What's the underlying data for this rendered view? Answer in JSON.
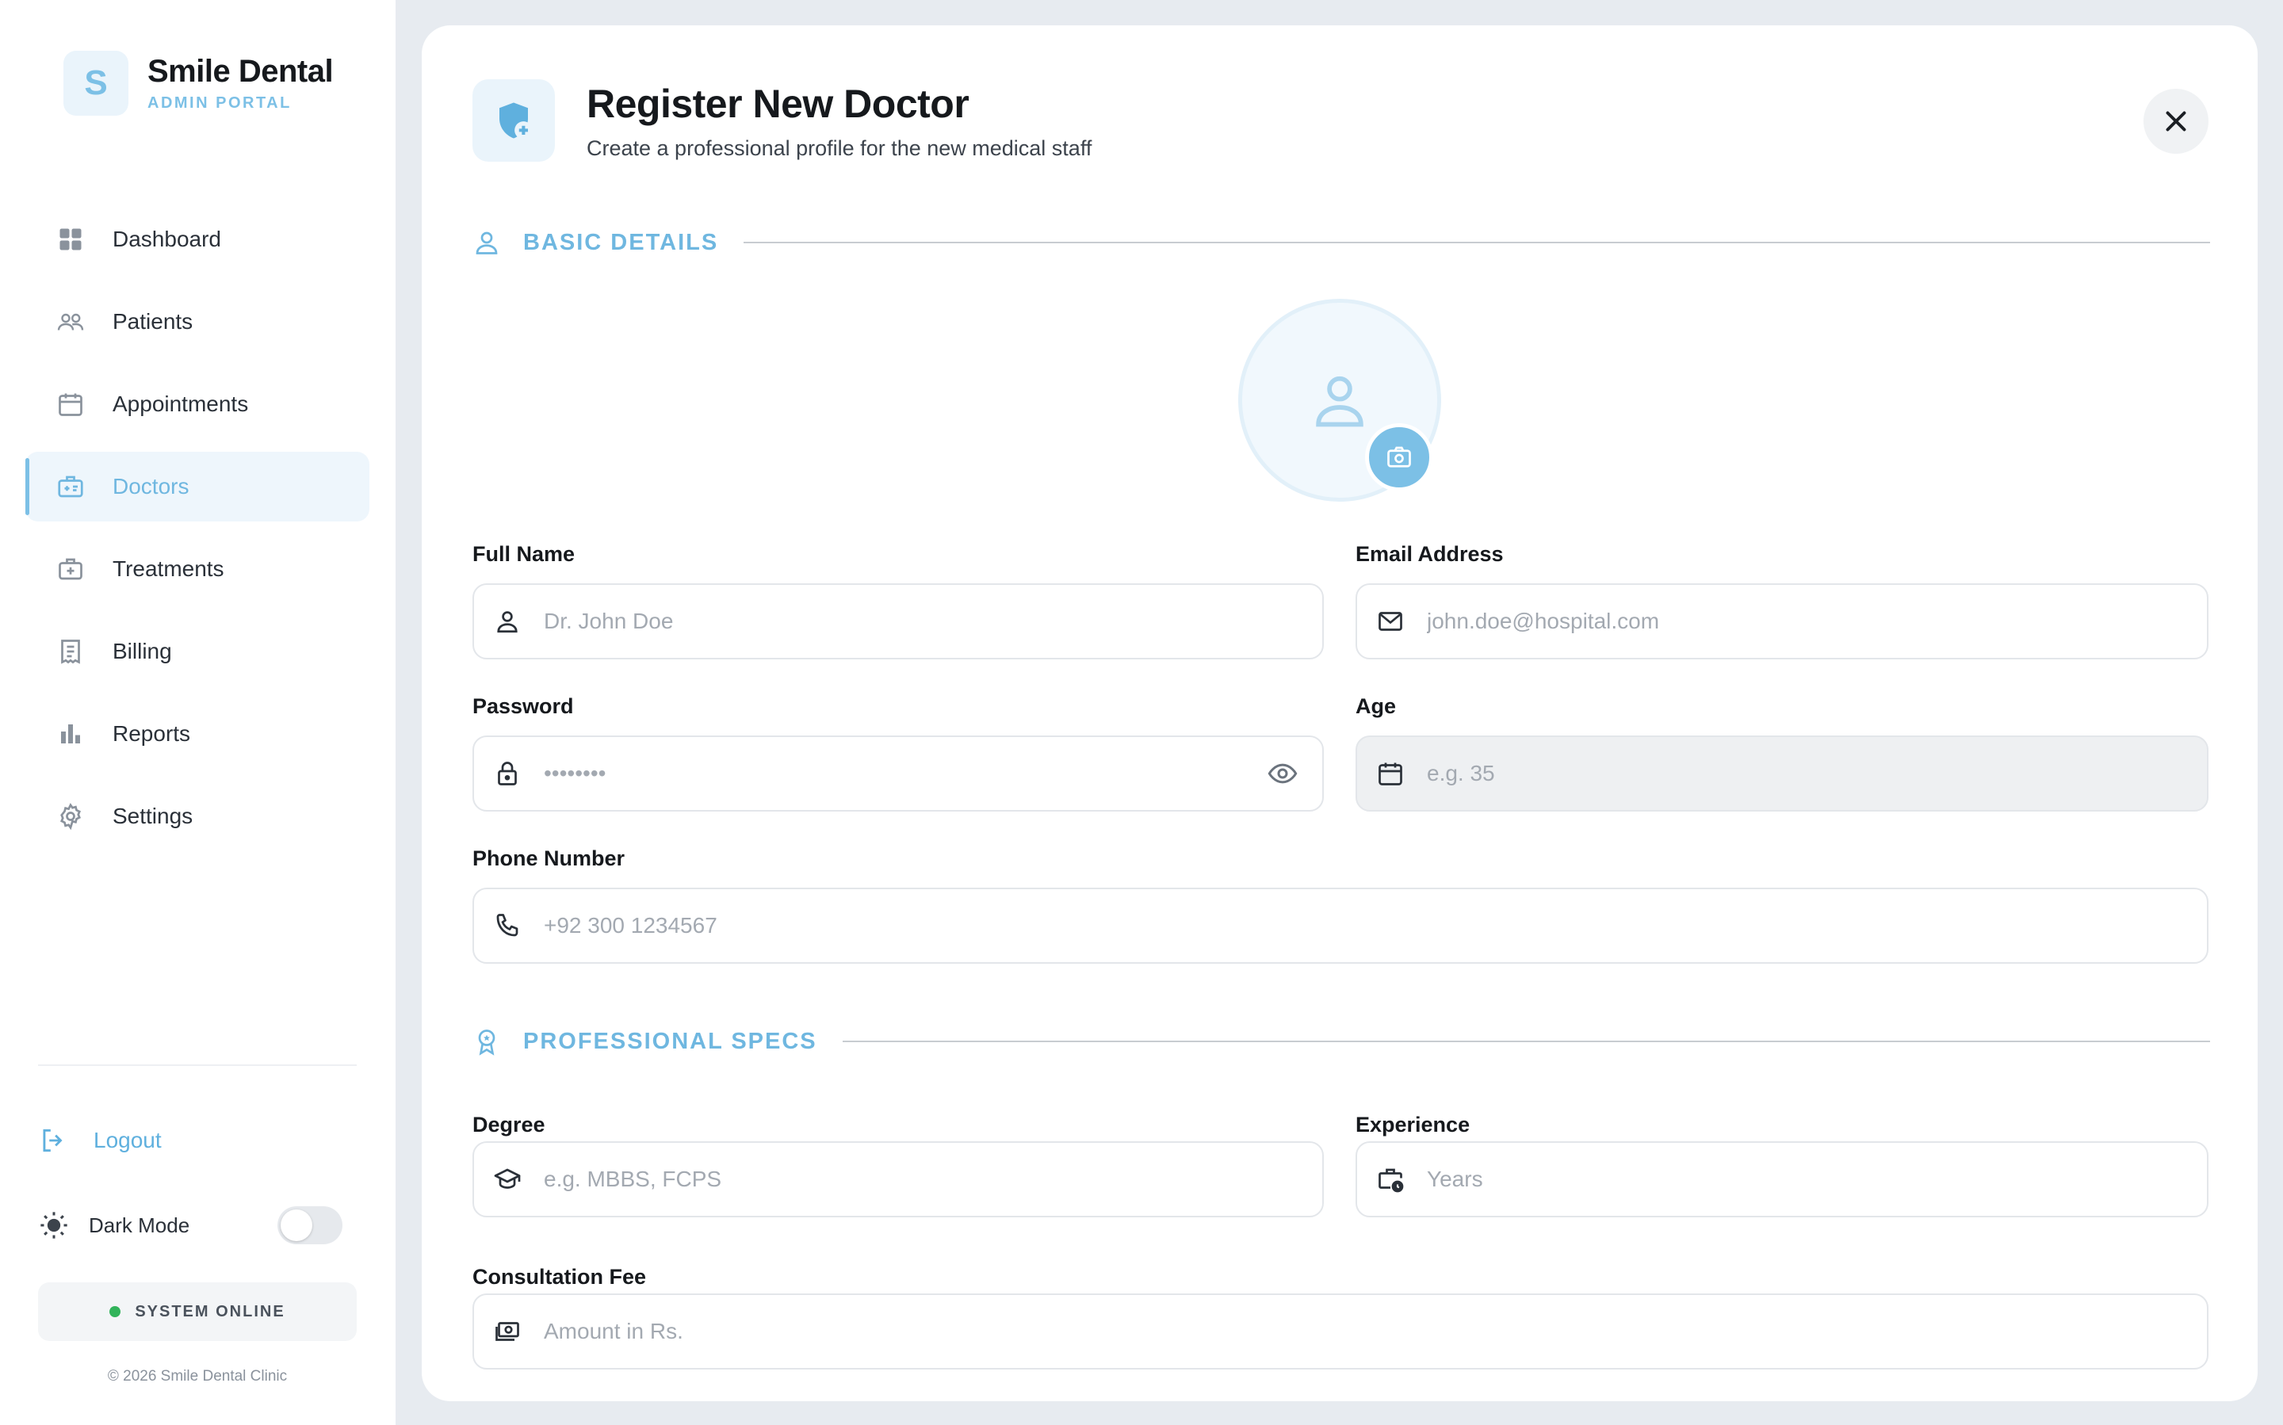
{
  "colors": {
    "accent": "#7cc0e6",
    "accent_text": "#6fb7e0",
    "status_online": "#31b35a",
    "background": "#e7ebf0"
  },
  "brand": {
    "logo_letter": "S",
    "name": "Smile Dental",
    "subtitle": "ADMIN PORTAL"
  },
  "sidebar": {
    "items": [
      {
        "label": "Dashboard",
        "icon": "grid-icon"
      },
      {
        "label": "Patients",
        "icon": "users-icon"
      },
      {
        "label": "Appointments",
        "icon": "calendar-icon"
      },
      {
        "label": "Doctors",
        "icon": "medical-id-icon",
        "active": true
      },
      {
        "label": "Treatments",
        "icon": "medical-case-icon"
      },
      {
        "label": "Billing",
        "icon": "receipt-icon"
      },
      {
        "label": "Reports",
        "icon": "bar-chart-icon"
      },
      {
        "label": "Settings",
        "icon": "gear-icon"
      }
    ],
    "logout_label": "Logout",
    "dark_mode_label": "Dark Mode",
    "dark_mode_on": false,
    "system_status": "SYSTEM ONLINE",
    "copyright": "© 2026 Smile Dental Clinic"
  },
  "modal": {
    "title": "Register New Doctor",
    "subtitle": "Create a professional profile for the new medical staff",
    "sections": {
      "basic": "BASIC DETAILS",
      "professional": "PROFESSIONAL SPECS"
    },
    "fields": {
      "full_name": {
        "label": "Full Name",
        "placeholder": "Dr. John Doe",
        "value": ""
      },
      "email": {
        "label": "Email Address",
        "placeholder": "john.doe@hospital.com",
        "value": ""
      },
      "password": {
        "label": "Password",
        "placeholder": "••••••••",
        "value": ""
      },
      "age": {
        "label": "Age",
        "placeholder": "e.g. 35",
        "value": "",
        "disabled": true
      },
      "phone": {
        "label": "Phone Number",
        "placeholder": "+92 300 1234567",
        "value": ""
      },
      "degree": {
        "label": "Degree",
        "placeholder": "e.g. MBBS, FCPS",
        "value": ""
      },
      "experience": {
        "label": "Experience",
        "placeholder": "Years",
        "value": ""
      },
      "fee": {
        "label": "Consultation Fee",
        "placeholder": "Amount in Rs.",
        "value": ""
      }
    }
  }
}
